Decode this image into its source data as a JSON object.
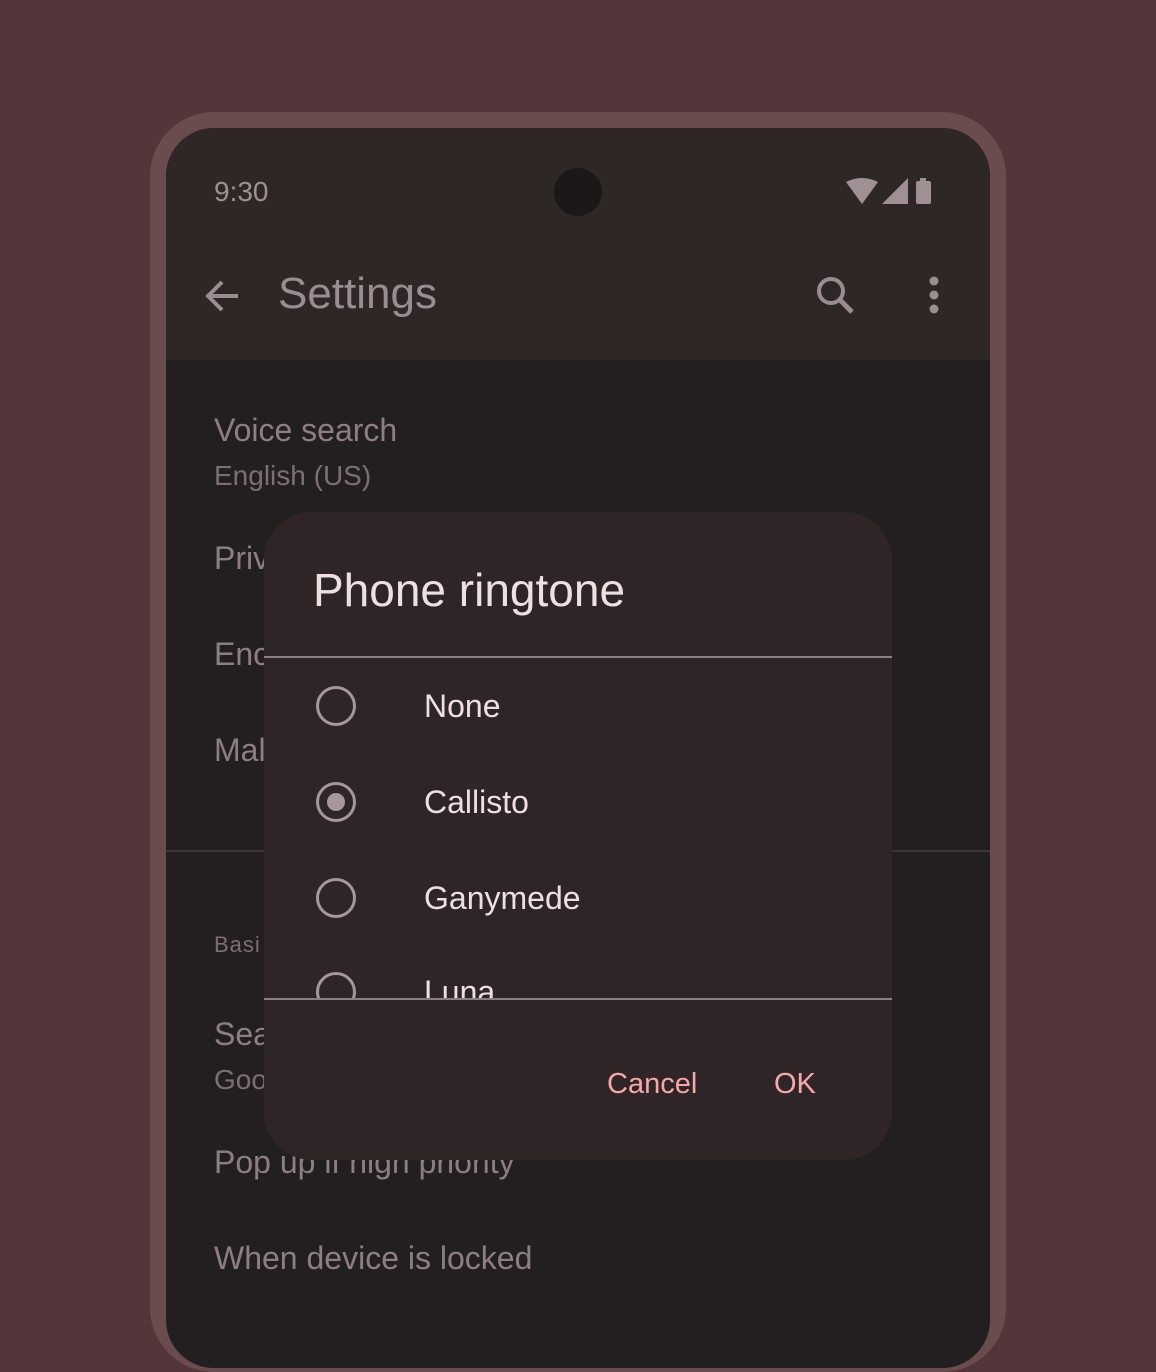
{
  "colors": {
    "background": "#533639",
    "screen": "#231f20",
    "dialog_surface": "#302526",
    "accent": "#f4a8ae"
  },
  "status_bar": {
    "time": "9:30",
    "icons": [
      "wifi-icon",
      "cellular-signal-icon",
      "battery-icon"
    ]
  },
  "app_bar": {
    "title": "Settings",
    "icons": [
      "back-arrow-icon",
      "search-icon",
      "more-vertical-icon"
    ]
  },
  "settings": {
    "voice_search_title": "Voice search",
    "voice_search_sub": "English (US)",
    "privacy_partial": "Priv",
    "enc_partial": "Enc",
    "mal_partial": "Mal",
    "basic_partial": "Basi",
    "search_partial": "Sea",
    "google_partial": "Goo",
    "popup_title": "Pop up if high priority",
    "locked_title": "When device is locked"
  },
  "dialog": {
    "title": "Phone ringtone",
    "options": [
      {
        "label": "None",
        "selected": false
      },
      {
        "label": "Callisto",
        "selected": true
      },
      {
        "label": "Ganymede",
        "selected": false
      },
      {
        "label": "Luna",
        "selected": false
      }
    ],
    "cancel_label": "Cancel",
    "ok_label": "OK"
  }
}
